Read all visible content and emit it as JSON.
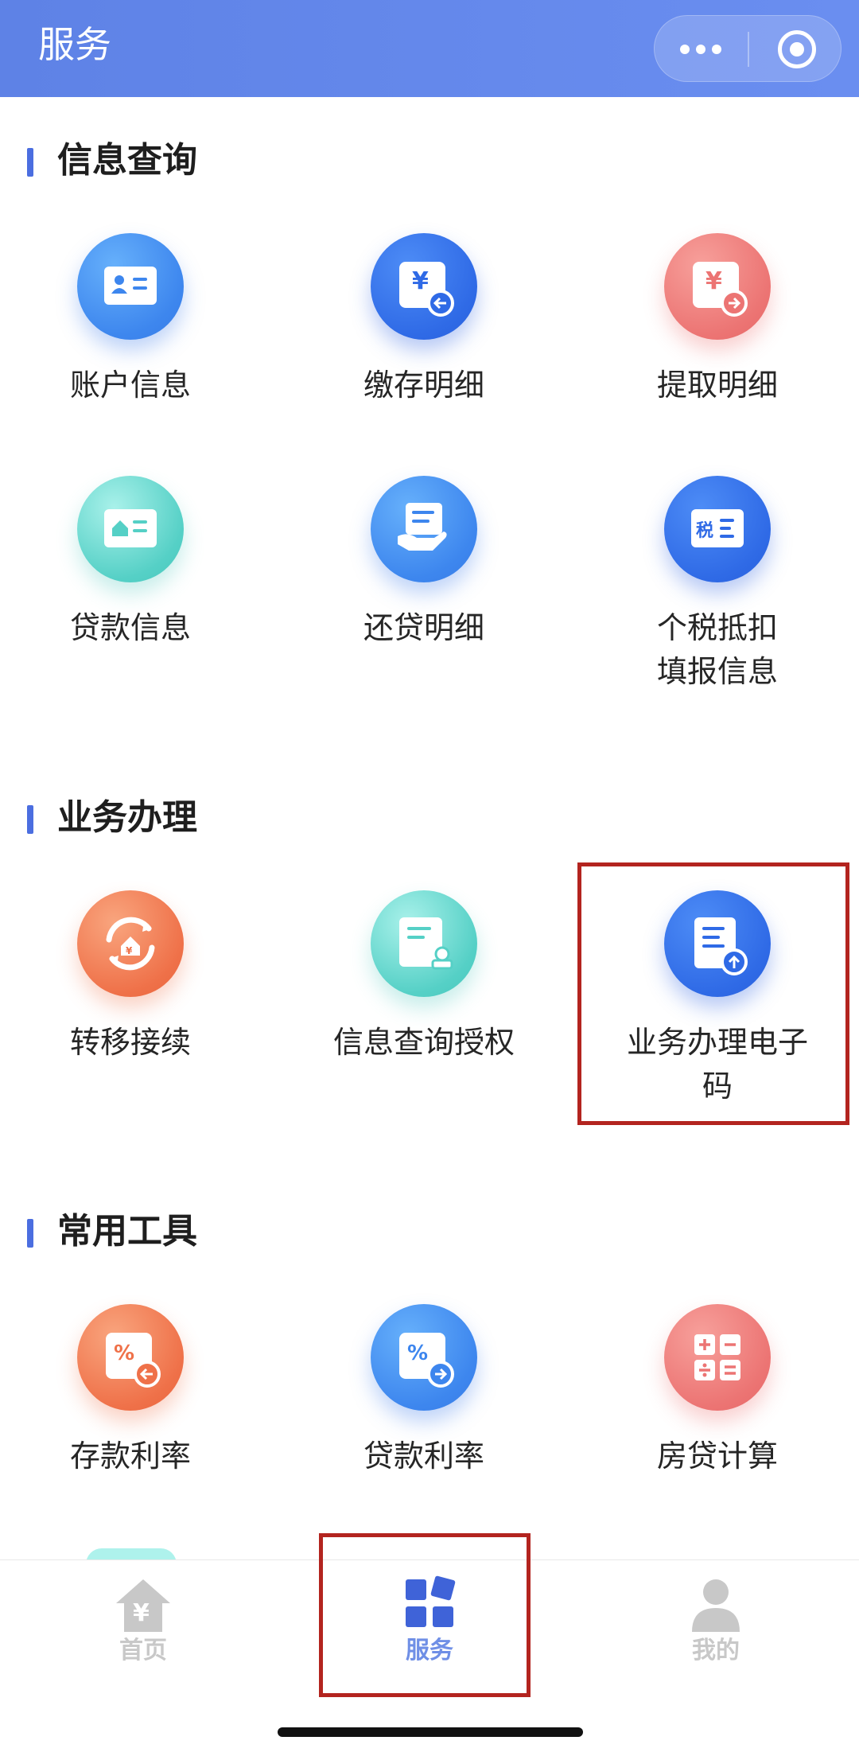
{
  "header": {
    "title": "服务",
    "more_icon": "more-dots-icon",
    "close_icon": "target-close-icon"
  },
  "sections": {
    "query": {
      "title": "信息查询",
      "items": [
        {
          "label": "账户信息",
          "icon": "id-card-icon",
          "color": "#3d86ee"
        },
        {
          "label": "缴存明细",
          "icon": "yuan-deposit-icon",
          "color": "#2f6ae6"
        },
        {
          "label": "提取明细",
          "icon": "yuan-withdraw-icon",
          "color": "#ec7473"
        },
        {
          "label": "贷款信息",
          "icon": "house-card-icon",
          "color": "#55d0c6"
        },
        {
          "label": "还贷明细",
          "icon": "hand-document-icon",
          "color": "#3d86ee"
        },
        {
          "label": "个税抵扣\n填报信息",
          "icon": "tax-icon",
          "color": "#2f6ae6"
        }
      ]
    },
    "business": {
      "title": "业务办理",
      "items": [
        {
          "label": "转移接续",
          "icon": "transfer-house-icon",
          "color": "#ef7149"
        },
        {
          "label": "信息查询授权",
          "icon": "document-stamp-icon",
          "color": "#55d0c6"
        },
        {
          "label": "业务办理电子\n码",
          "icon": "document-upload-icon",
          "color": "#2f6ae6"
        }
      ]
    },
    "tools": {
      "title": "常用工具",
      "items": [
        {
          "label": "存款利率",
          "icon": "percent-in-icon",
          "color": "#ef7149"
        },
        {
          "label": "贷款利率",
          "icon": "percent-out-icon",
          "color": "#3d86ee"
        },
        {
          "label": "房贷计算",
          "icon": "calculator-icon",
          "color": "#ec7473"
        }
      ]
    }
  },
  "tabbar": {
    "tabs": [
      {
        "label": "首页",
        "icon": "home-yuan-icon",
        "active": false,
        "color": "#c8c8c8"
      },
      {
        "label": "服务",
        "icon": "service-blocks-icon",
        "active": true,
        "color": "#4b6ee0"
      },
      {
        "label": "我的",
        "icon": "person-icon",
        "active": false,
        "color": "#c8c8c8"
      }
    ]
  },
  "colors": {
    "header": "#6a8ef0",
    "accent": "#4b6ee0",
    "highlight": "#b3241f"
  }
}
